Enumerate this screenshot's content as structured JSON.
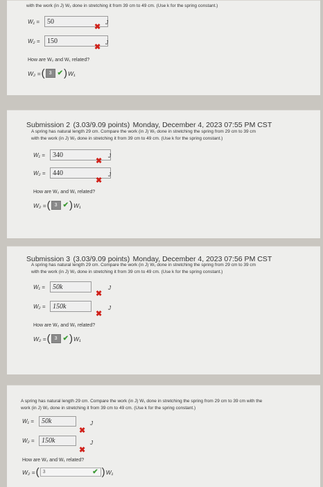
{
  "top": {
    "prompt_tail": "with the work (in J) W₂ done in stretching it from 39 cm to 49 cm. (Use k for the spring constant.)",
    "w1_label": "W₁ =",
    "w1_value": "50",
    "w2_label": "W₂ =",
    "w2_value": "150",
    "unit": "J",
    "question": "How are W₂ and W₁ related?",
    "rel_left": "W₂ =",
    "rel_value": "3",
    "rel_right": "W₁"
  },
  "submission2": {
    "title": "Submission 2",
    "points": "(3.03/9.09 points)",
    "date": "Monday, December 4, 2023 07:55 PM CST",
    "problem_line1": "A spring has natural length 29 cm. Compare the work (in J) W₁ done in stretching the spring from 29 cm to 39 cm",
    "problem_line2": "with the work (in J) W₂ done in stretching it from 39 cm to 49 cm. (Use k for the spring constant.)",
    "w1_label": "W₁ =",
    "w1_value": "340",
    "w2_label": "W₂ =",
    "w2_value": "440",
    "unit": "J",
    "question": "How are W₂ and W₁ related?",
    "rel_left": "W₂ =",
    "rel_value": "3",
    "rel_right": "W₁"
  },
  "submission3": {
    "title": "Submission 3",
    "points": "(3.03/9.09 points)",
    "date": "Monday, December 4, 2023 07:56 PM CST",
    "problem_line1": "A spring has natural length 29 cm. Compare the work (in J) W₁ done in stretching the spring from 29 cm to 39 cm",
    "problem_line2": "with the work (in J) W₂ done in stretching it from 39 cm to 49 cm. (Use k for the spring constant.)",
    "w1_label": "W₁ =",
    "w1_value": "50k",
    "w2_label": "W₂ =",
    "w2_value": "150k",
    "unit": "J",
    "question": "How are W₂ and W₁ related?",
    "rel_left": "W₂ =",
    "rel_value": "3",
    "rel_right": "W₁"
  },
  "current": {
    "problem_line1": "A spring has natural length 29 cm. Compare the work (in J) W₁ done in stretching the spring from 29 cm to 39 cm with the",
    "problem_line2": "work (in J) W₂ done in stretching it from 39 cm to 49 cm. (Use k for the spring constant.)",
    "w1_label": "W₁ =",
    "w1_value": "50k",
    "w2_label": "W₂ =",
    "w2_value": "150k",
    "unit": "J",
    "question": "How are W₂ and W₁ related?",
    "rel_left": "W₂ =",
    "rel_value": "3",
    "rel_right": "W₁"
  },
  "icons": {
    "incorrect": "x-mark-icon",
    "correct": "check-mark-icon"
  }
}
